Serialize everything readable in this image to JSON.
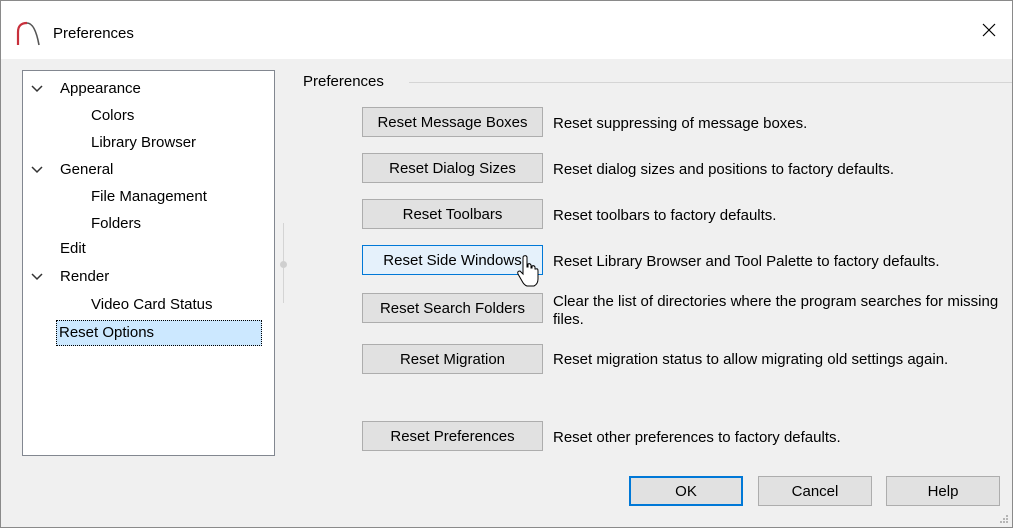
{
  "window": {
    "title": "Preferences",
    "icons": {
      "app": "arc-icon",
      "close": "close-icon"
    }
  },
  "tree": {
    "items": [
      {
        "label": "Appearance",
        "level": 0,
        "expanded": true
      },
      {
        "label": "Colors",
        "level": 1
      },
      {
        "label": "Library Browser",
        "level": 1
      },
      {
        "label": "General",
        "level": 0,
        "expanded": true
      },
      {
        "label": "File Management",
        "level": 1
      },
      {
        "label": "Folders",
        "level": 1
      },
      {
        "label": "Edit",
        "level": 0
      },
      {
        "label": "Render",
        "level": 0,
        "expanded": true
      },
      {
        "label": "Video Card Status",
        "level": 1
      },
      {
        "label": "Reset Options",
        "level": 0,
        "selected": true
      }
    ]
  },
  "panel": {
    "group_label": "Preferences",
    "rows": [
      {
        "button": "Reset Message Boxes",
        "description": "Reset suppressing of message boxes."
      },
      {
        "button": "Reset Dialog Sizes",
        "description": "Reset dialog sizes and positions to factory defaults."
      },
      {
        "button": "Reset Toolbars",
        "description": "Reset toolbars to factory defaults."
      },
      {
        "button": "Reset Side Windows",
        "description": "Reset Library Browser and Tool Palette to factory defaults.",
        "hovered": true
      },
      {
        "button": "Reset Search Folders",
        "description": "Clear the list of directories where the program searches for missing files."
      },
      {
        "button": "Reset Migration",
        "description": "Reset migration status to allow migrating old settings again."
      },
      {
        "button": "Reset Preferences",
        "description": "Reset other preferences to factory defaults."
      }
    ]
  },
  "footer": {
    "ok_label": "OK",
    "cancel_label": "Cancel",
    "help_label": "Help"
  },
  "colors": {
    "accent": "#0078d7",
    "selection": "#cce8ff",
    "app_icon": "#c8303c"
  }
}
